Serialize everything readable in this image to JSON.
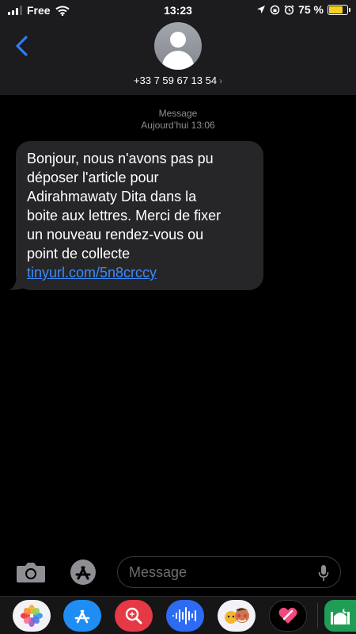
{
  "status_bar": {
    "carrier": "Free",
    "time": "13:23",
    "battery_percent": "75 %",
    "battery_level": 0.75,
    "battery_color": "#f7d21c"
  },
  "header": {
    "contact": "+33 7 59 67 13 54",
    "back_icon": "chevron-left-icon",
    "accent": "#2f7cf6"
  },
  "thread": {
    "label": "Message",
    "timestamp": "Aujourd’hui 13:06"
  },
  "message": {
    "lines": [
      "Bonjour, nous n'avons pas pu",
      "déposer l'article pour",
      "Adirahmawaty Dita dans la",
      "boite aux lettres. Merci de fixer",
      "un nouveau rendez-vous ou",
      "point de collecte"
    ],
    "link": "tinyurl.com/5n8crccy",
    "link_color": "#3a8bfe"
  },
  "composer": {
    "placeholder": "Message"
  },
  "app_strip": {
    "apps": [
      "photos-icon",
      "app-store-icon",
      "search-images-icon",
      "audio-message-icon",
      "memoji-icon",
      "digital-touch-icon",
      "mosque-app-icon"
    ]
  }
}
